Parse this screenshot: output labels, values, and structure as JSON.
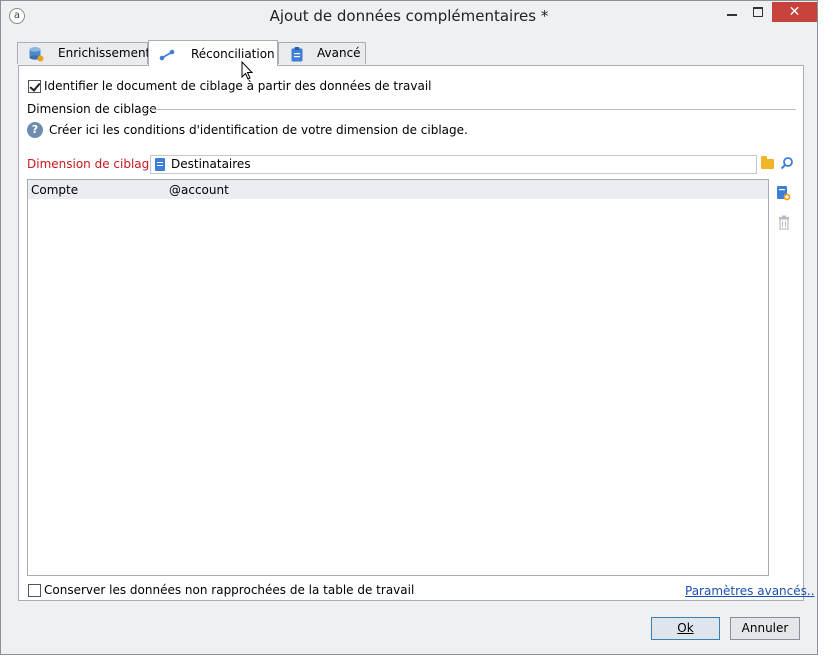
{
  "window": {
    "title": "Ajout de données complémentaires *"
  },
  "tabs": [
    {
      "label": "Enrichissement",
      "icon": "database-icon"
    },
    {
      "label": "Réconciliation",
      "icon": "reconciliation-icon"
    },
    {
      "label": "Avancé",
      "icon": "clipboard-icon"
    }
  ],
  "main": {
    "identify_checkbox_label": "Identifier le document de ciblage à partir des données de travail",
    "identify_checked": true,
    "section_title": "Dimension de ciblage",
    "help_text": "Créer ici les conditions d'identification de votre dimension de ciblage.",
    "dimension_label": "Dimension de ciblage:",
    "dimension_value": "Destinataires",
    "grid_rows": [
      {
        "field": "Compte",
        "expression": "@account"
      }
    ],
    "keep_checkbox_label": "Conserver les données non rapprochées de la table de travail",
    "keep_checked": false,
    "advanced_link": "Paramètres avancés.."
  },
  "footer": {
    "ok_label": "Ok",
    "cancel_label": "Annuler"
  },
  "colors": {
    "required_label": "#c8191e",
    "link": "#1b4fb3",
    "close_button": "#c7423a"
  }
}
